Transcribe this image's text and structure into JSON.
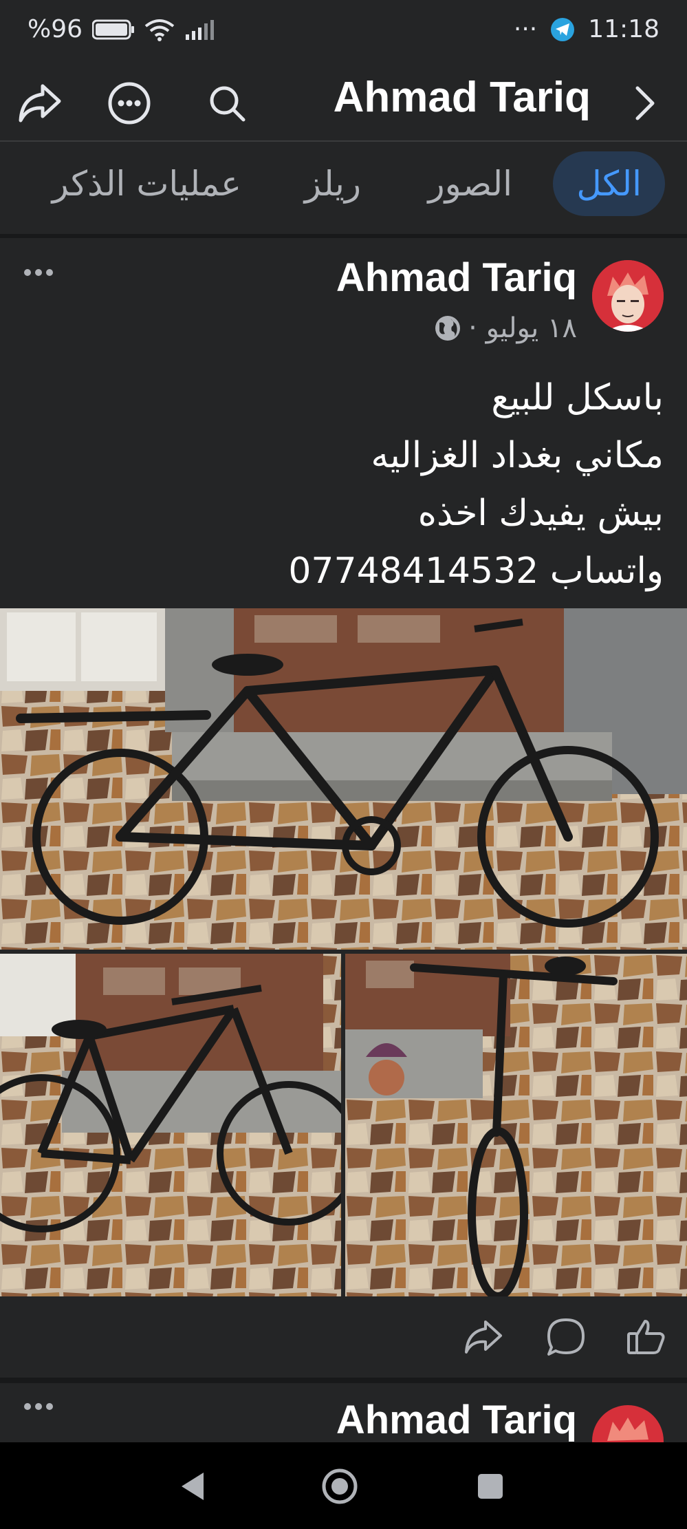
{
  "status_bar": {
    "battery": "%96",
    "time": "11:18",
    "more": "···"
  },
  "header": {
    "title": "Ahmad Tariq",
    "icons": [
      "share-icon",
      "more-icon",
      "search-icon",
      "chevron-right-icon"
    ]
  },
  "tabs": [
    {
      "label": "الكل",
      "active": true
    },
    {
      "label": "الصور",
      "active": false
    },
    {
      "label": "ريلز",
      "active": false
    },
    {
      "label": "عمليات الذكر",
      "active": false
    }
  ],
  "post": {
    "author": "Ahmad Tariq",
    "date": "١٨ يوليو ·",
    "privacy_icon": "globe-icon",
    "lines": [
      "باسكل للبيع",
      "مكاني بغداد الغزاليه",
      "بيش يفيدك اخذه",
      "واتساب 07748414532"
    ],
    "actions": [
      "like-icon",
      "comment-icon",
      "share-icon"
    ]
  },
  "post2": {
    "author": "Ahmad Tariq"
  },
  "colors": {
    "background": "#242526",
    "accent": "#4599ff",
    "active_tab_bg": "#263951",
    "avatar": "#d6303a"
  }
}
